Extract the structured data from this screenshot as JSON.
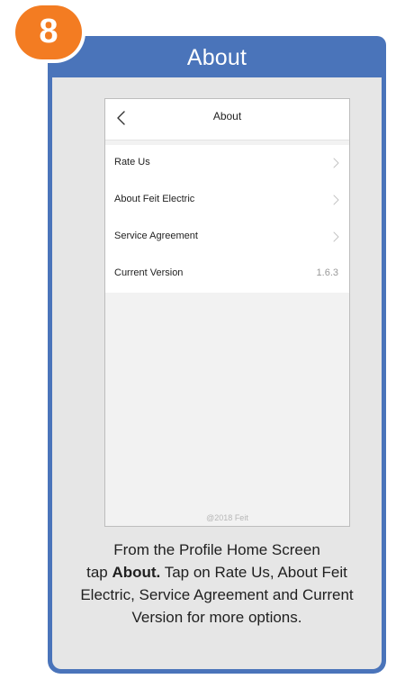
{
  "step": {
    "number": "8",
    "title": "About"
  },
  "colors": {
    "card_blue": "#4a74ba",
    "badge_orange": "#f37c22",
    "panel_gray": "#e6e6e6"
  },
  "phone": {
    "header": {
      "title": "About",
      "back_icon": "chevron-left-icon"
    },
    "menu": [
      {
        "label": "Rate Us",
        "icon": "chevron-right-icon"
      },
      {
        "label": "About Feit Electric",
        "icon": "chevron-right-icon"
      },
      {
        "label": "Service Agreement",
        "icon": "chevron-right-icon"
      },
      {
        "label": "Current Version",
        "value": "1.6.3"
      }
    ],
    "footer": "@2018 Feit"
  },
  "caption": {
    "line1": "From the Profile Home Screen",
    "before_bold": "tap ",
    "bold": "About.",
    "after_bold": " Tap on Rate Us, About Feit Electric, Service Agreement and Current Version for more options."
  }
}
